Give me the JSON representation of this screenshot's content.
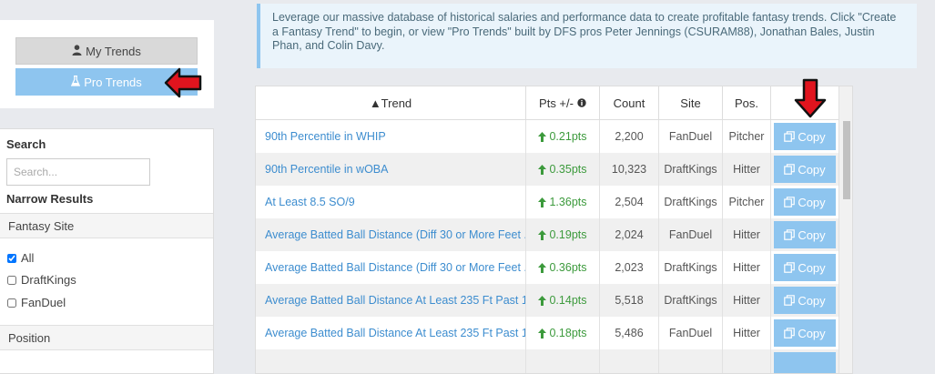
{
  "trend_nav": {
    "my_trends_label": "My Trends",
    "pro_trends_label": "Pro Trends",
    "my_trends_icon": "user-icon",
    "pro_trends_icon": "flask-icon"
  },
  "info": {
    "text": "Leverage our massive database of historical salaries and performance data to create profitable fantasy trends. Click \"Create a Fantasy Trend\" to begin, or view \"Pro Trends\" built by DFS pros Peter Jennings (CSURAM88), Jonathan Bales, Justin Phan, and Colin Davy."
  },
  "filters": {
    "search_label": "Search",
    "search_placeholder": "Search...",
    "narrow_label": "Narrow Results",
    "site_section": "Fantasy Site",
    "site_options": [
      {
        "label": "All",
        "checked": true
      },
      {
        "label": "DraftKings",
        "checked": false
      },
      {
        "label": "FanDuel",
        "checked": false
      }
    ],
    "position_section": "Position"
  },
  "table": {
    "headers": {
      "trend": "▲Trend",
      "pts": "Pts +/-",
      "count": "Count",
      "site": "Site",
      "pos": "Pos."
    },
    "copy_label": "Copy",
    "rows": [
      {
        "trend": "90th Percentile in WHIP",
        "pts": "0.21pts",
        "count": "2,200",
        "site": "FanDuel",
        "pos": "Pitcher"
      },
      {
        "trend": "90th Percentile in wOBA",
        "pts": "0.35pts",
        "count": "10,323",
        "site": "DraftKings",
        "pos": "Hitter"
      },
      {
        "trend": "At Least 8.5 SO/9",
        "pts": "1.36pts",
        "count": "2,504",
        "site": "DraftKings",
        "pos": "Pitcher"
      },
      {
        "trend": "Average Batted Ball Distance (Diff 30 or More Feet ...",
        "pts": "0.19pts",
        "count": "2,024",
        "site": "FanDuel",
        "pos": "Hitter"
      },
      {
        "trend": "Average Batted Ball Distance (Diff 30 or More Feet ...",
        "pts": "0.36pts",
        "count": "2,023",
        "site": "DraftKings",
        "pos": "Hitter"
      },
      {
        "trend": "Average Batted Ball Distance At Least 235 Ft Past 1...",
        "pts": "0.14pts",
        "count": "5,518",
        "site": "DraftKings",
        "pos": "Hitter"
      },
      {
        "trend": "Average Batted Ball Distance At Least 235 Ft Past 1...",
        "pts": "0.18pts",
        "count": "5,486",
        "site": "FanDuel",
        "pos": "Hitter"
      }
    ]
  },
  "colors": {
    "accent": "#8ec5ef",
    "link": "#3d8dcf",
    "positive": "#3c9a3c",
    "annotation": "#e0141e"
  }
}
